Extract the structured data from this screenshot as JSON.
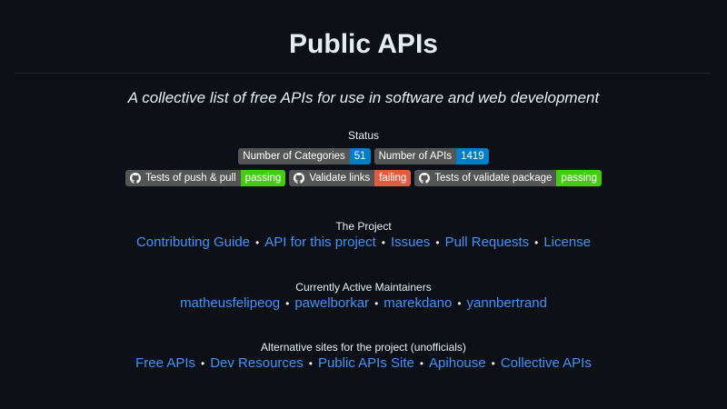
{
  "header": {
    "title": "Public APIs",
    "subtitle": "A collective list of free APIs for use in software and web development"
  },
  "status": {
    "label": "Status",
    "counts": [
      {
        "label": "Number of Categories",
        "value": "51",
        "color": "#007ec6"
      },
      {
        "label": "Number of APIs",
        "value": "1419",
        "color": "#007ec6"
      }
    ],
    "workflows": [
      {
        "icon": "github-icon",
        "label": "Tests of push & pull",
        "value": "passing",
        "color": "#4c1"
      },
      {
        "icon": "github-icon",
        "label": "Validate links",
        "value": "failing",
        "color": "#e05d44"
      },
      {
        "icon": "github-icon",
        "label": "Tests of validate package",
        "value": "passing",
        "color": "#4c1"
      }
    ]
  },
  "project": {
    "label": "The Project",
    "links": [
      "Contributing Guide",
      "API for this project",
      "Issues",
      "Pull Requests",
      "License"
    ]
  },
  "maintainers": {
    "label": "Currently Active Maintainers",
    "links": [
      "matheusfelipeog",
      "pawelborkar",
      "marekdano",
      "yannbertrand"
    ]
  },
  "alternatives": {
    "label": "Alternative sites for the project (unofficials)",
    "links": [
      "Free APIs",
      "Dev Resources",
      "Public APIs Site",
      "Apihouse",
      "Collective APIs"
    ]
  },
  "separator": "•",
  "colors": {
    "background": "#0d1117",
    "link": "#4493f8",
    "text": "#e6edf3",
    "badge_label": "#555555"
  }
}
